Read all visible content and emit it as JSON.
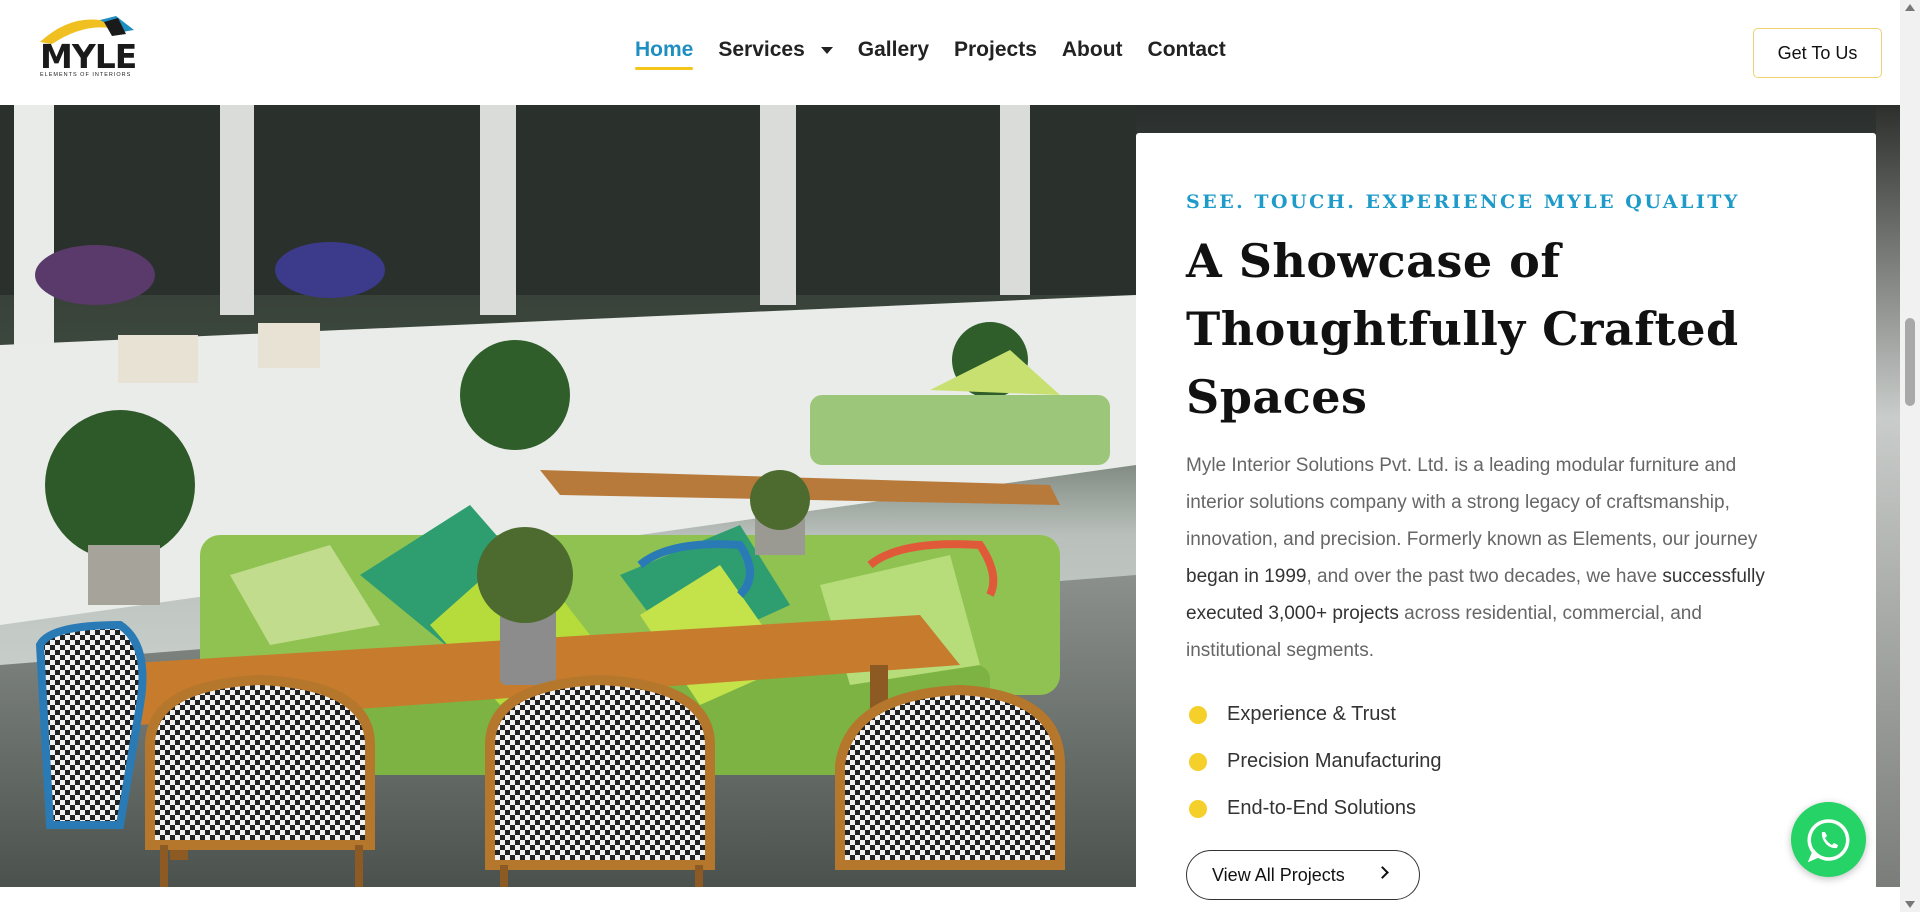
{
  "brand": {
    "logo_text": "MYLE",
    "tagline": "ELEMENTS OF INTERIORS",
    "accent_yellow": "#f5c518",
    "accent_blue": "#1f8fc2"
  },
  "nav": {
    "items": [
      {
        "label": "Home",
        "active": true
      },
      {
        "label": "Services",
        "has_dropdown": true
      },
      {
        "label": "Gallery"
      },
      {
        "label": "Projects"
      },
      {
        "label": "About"
      },
      {
        "label": "Contact"
      }
    ],
    "cta_label": "Get To Us"
  },
  "hero": {
    "image_alt": "Outdoor patio with green sofa, wooden tables and rattan chairs",
    "eyebrow": "SEE. TOUCH. EXPERIENCE MYLE QUALITY",
    "heading": "A Showcase of Thoughtfully Crafted Spaces",
    "description": {
      "part1": "Myle Interior Solutions Pvt. Ltd. is a leading modular furniture and interior solutions company with a strong legacy of craftsmanship, innovation, and precision. Formerly known as Elements, our journey ",
      "bold1": "began in 1999",
      "part2": ", and over the past two decades, we have ",
      "bold2": "successfully executed 3,000+ projects",
      "part3": " across residential, commercial, and institutional segments."
    },
    "features": [
      "Experience & Trust",
      "Precision Manufacturing",
      "End-to-End Solutions"
    ],
    "button_label": "View All Projects"
  },
  "floating": {
    "whatsapp_icon": "whatsapp-icon"
  }
}
